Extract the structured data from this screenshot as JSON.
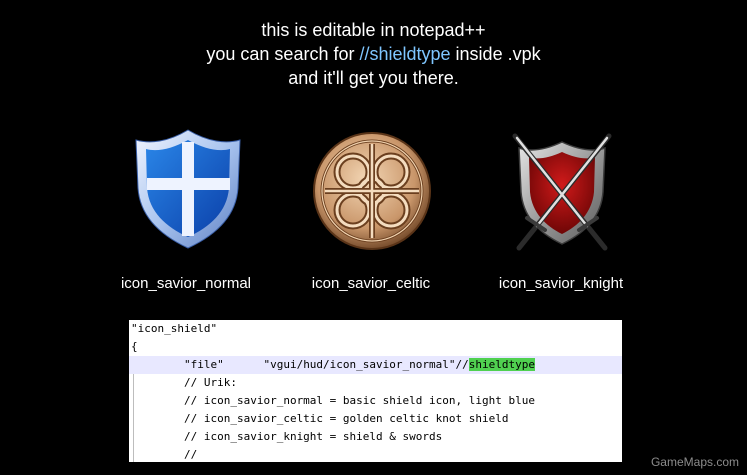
{
  "header": {
    "line1": "this is editable in notepad++",
    "line2_prefix": "you can search for ",
    "line2_highlight": "//shieldtype",
    "line2_suffix": " inside .vpk",
    "line3": "and it'll get you there."
  },
  "icons": [
    {
      "label": "icon_savior_normal",
      "icon": "blue-shield-icon"
    },
    {
      "label": "icon_savior_celtic",
      "icon": "celtic-knot-icon"
    },
    {
      "label": "icon_savior_knight",
      "icon": "shield-swords-icon"
    }
  ],
  "code": {
    "line1": "\"icon_shield\"",
    "line2": "{",
    "line3_key": "        \"file\"      ",
    "line3_value": "\"vgui/hud/icon_savior_normal\"//",
    "line3_match": "shieldtype",
    "line4": "        // Urik:",
    "line5": "        // icon_savior_normal = basic shield icon, light blue",
    "line6": "        // icon_savior_celtic = golden celtic knot shield",
    "line7": "        // icon_savior_knight = shield & swords",
    "line8": "        //"
  },
  "colors": {
    "background": "#000000",
    "highlight_text": "#7fc6ff",
    "search_match": "#50d050"
  },
  "watermark": "GameMaps.com"
}
